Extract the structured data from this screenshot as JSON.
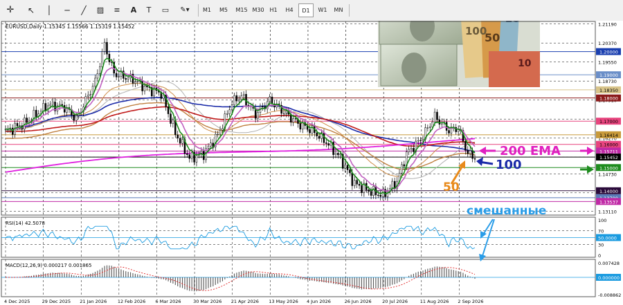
{
  "toolbar": {
    "timeframes": [
      "M1",
      "M5",
      "M15",
      "M30",
      "H1",
      "H4",
      "D1",
      "W1",
      "MN"
    ],
    "active_timeframe": "D1"
  },
  "chart_data": {
    "type": "line",
    "title": "EURUSD,Daily  1.15345 1.15566 1.15319 1.15452",
    "x_ticks": [
      "4 Dec 2025",
      "29 Dec 2025",
      "21 Jan 2026",
      "12 Feb 2026",
      "6 Mar 2026",
      "30 Mar 2026",
      "21 Apr 2026",
      "13 May 2026",
      "4 Jun 2026",
      "26 Jun 2026",
      "20 Jul 2026",
      "11 Aug 2026",
      "2 Sep 2026"
    ],
    "y_ticks": [
      "1.21190",
      "1.20370",
      "1.19550",
      "1.18730",
      "1.17910",
      "1.17090",
      "1.16270",
      "1.15450",
      "1.14730",
      "1.13910",
      "1.13110"
    ],
    "ylim": [
      1.1295,
      1.213
    ],
    "level_lines": [
      {
        "label": "1.20000",
        "value": 1.2,
        "color": "#1a3fb0"
      },
      {
        "label": "1.19000",
        "value": 1.19,
        "color": "#6a8ec8"
      },
      {
        "label": "1.18350",
        "value": 1.1835,
        "color": "#d8c48a"
      },
      {
        "label": "1.18000",
        "value": 1.18,
        "color": "#8b1a1a"
      },
      {
        "label": "1.17000",
        "value": 1.17,
        "color": "#e8447e"
      },
      {
        "label": "1.16414",
        "value": 1.16414,
        "color": "#c89a3a"
      },
      {
        "label": "1.16000",
        "value": 1.16,
        "color": "#e8447e"
      },
      {
        "label": "1.15711",
        "value": 1.15711,
        "color": "#c02aa6"
      },
      {
        "label": "1.15452",
        "value": 1.15452,
        "color": "#000000"
      },
      {
        "label": "1.15000",
        "value": 1.15,
        "color": "#1e8c1e"
      },
      {
        "label": "1.14000",
        "value": 1.14,
        "color": "#2a0a3a"
      },
      {
        "label": "1.13700",
        "value": 1.137,
        "color": "#5a7ab8"
      },
      {
        "label": "1.13537",
        "value": 1.13537,
        "color": "#c02aa6"
      }
    ],
    "series": [
      {
        "name": "EURUSD",
        "color": "#000000"
      },
      {
        "color": "#1a8a1a"
      },
      {
        "color": "#b0b0b0"
      },
      {
        "color": "#cc8a44"
      },
      {
        "color": "#c060c0"
      },
      {
        "color": "#c08040"
      },
      {
        "color": "#1a2aa8"
      },
      {
        "color": "#c01818"
      },
      {
        "color": "#e020e0"
      }
    ],
    "annotations": [
      {
        "text": "200 EMA",
        "color": "#e020c0"
      },
      {
        "text": "100",
        "color": "#1a2aa8"
      },
      {
        "text": "50",
        "color": "#e88a1a"
      },
      {
        "text": "смешанные",
        "color": "#2a9de8"
      }
    ],
    "rsi": {
      "label": "RSI(14) 42.5078",
      "y_ticks": [
        "100",
        "70",
        "50.0000",
        "30",
        "0"
      ],
      "ylim": [
        0,
        100
      ]
    },
    "macd": {
      "label": "MACD(12,26,9) 0.000217 0.001865",
      "y_ticks": [
        "0.007428",
        "0.000000",
        "-0.008862"
      ],
      "ylim": [
        -0.008862,
        0.007428
      ]
    }
  }
}
